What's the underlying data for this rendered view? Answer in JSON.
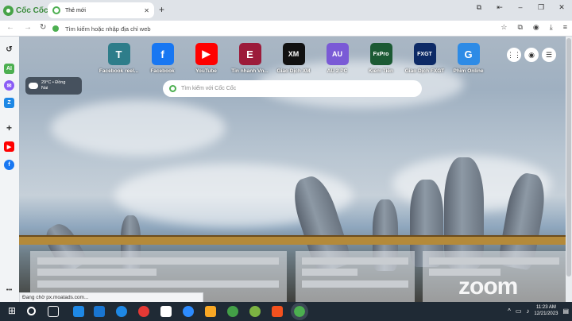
{
  "browser": {
    "brand": "Cốc Cốc",
    "tab_title": "Thẻ mới",
    "address_placeholder": "Tìm kiếm hoặc nhập địa chỉ web"
  },
  "shortcuts": [
    {
      "label": "Facebook reel...",
      "glyph": "T",
      "color": "#2e7d8a"
    },
    {
      "label": "Facebook",
      "glyph": "f",
      "color": "#1877f2"
    },
    {
      "label": "YouTube",
      "glyph": "▶",
      "color": "#ff0000"
    },
    {
      "label": "Tin nhanh Vn...",
      "glyph": "E",
      "color": "#9c1b3a"
    },
    {
      "label": "Giao Dịch XM",
      "glyph": "XM",
      "color": "#111111"
    },
    {
      "label": "AU 2 PC",
      "glyph": "AU",
      "color": "#7a5ad6"
    },
    {
      "label": "Kiếm Tiền",
      "glyph": "FxPro",
      "color": "#1c5a34"
    },
    {
      "label": "Giao Dịch FXGT",
      "glyph": "FXGT",
      "color": "#0d2a66"
    },
    {
      "label": "Phim Online",
      "glyph": "G",
      "color": "#2d8be6"
    }
  ],
  "weather": {
    "temp": "29°C • Đồng",
    "place": "Nai"
  },
  "search": {
    "placeholder": "Tìm kiếm với Cốc Cốc"
  },
  "status_text": "Đang chờ px.moatads.com...",
  "watermark": "zoom",
  "clock": {
    "time": "11:23 AM",
    "date": "12/21/2023"
  }
}
